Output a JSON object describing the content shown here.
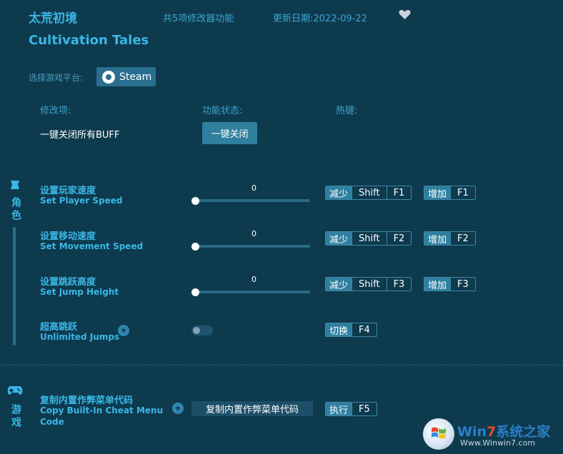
{
  "header": {
    "title_cn": "太荒初境",
    "title_en": "Cultivation Tales",
    "feature_count": "共5项修改器功能",
    "update_date": "更新日期:2022-09-22",
    "favorite_icon": "heart-icon"
  },
  "platform": {
    "label": "选择游戏平台:",
    "button": "Steam",
    "icon": "steam-icon"
  },
  "columns": {
    "item": "修改项:",
    "status": "功能状态:",
    "hotkey": "热键:"
  },
  "global": {
    "label": "一键关闭所有BUFF",
    "button": "一键关闭"
  },
  "sections": {
    "character": {
      "label": "角色",
      "icon": "character-icon"
    },
    "game": {
      "label": "游戏",
      "icon": "gamepad-icon"
    }
  },
  "items": [
    {
      "cn": "设置玩家速度",
      "en": "Set Player Speed",
      "value": "0",
      "dec": {
        "tag": "减少",
        "keys": [
          "Shift",
          "F1"
        ]
      },
      "inc": {
        "tag": "增加",
        "keys": [
          "F1"
        ]
      }
    },
    {
      "cn": "设置移动速度",
      "en": "Set Movement Speed",
      "value": "0",
      "dec": {
        "tag": "减少",
        "keys": [
          "Shift",
          "F2"
        ]
      },
      "inc": {
        "tag": "增加",
        "keys": [
          "F2"
        ]
      }
    },
    {
      "cn": "设置跳跃高度",
      "en": "Set Jump Height",
      "value": "0",
      "dec": {
        "tag": "减少",
        "keys": [
          "Shift",
          "F3"
        ]
      },
      "inc": {
        "tag": "增加",
        "keys": [
          "F3"
        ]
      }
    },
    {
      "cn": "超高跳跃",
      "en": "Unlimited Jumps",
      "star_icon": "star-icon",
      "toggle": {
        "tag": "切换",
        "keys": [
          "F4"
        ]
      }
    }
  ],
  "cheat_menu": {
    "cn": "复制内置作弊菜单代码",
    "en_line1": "Copy Built-In Cheat Menu",
    "en_line2": "Code",
    "button": "复制内置作弊菜单代码",
    "tag": "执行",
    "key": "F5",
    "star_icon": "star-icon"
  },
  "watermark": {
    "brand_w": "Win",
    "brand_7": "7",
    "brand_cn": "系统之家",
    "url": "Www.Winwin7.com"
  },
  "colors": {
    "background": "#0e3a4e",
    "accent": "#3ab7e6",
    "button": "#2f7f9f"
  }
}
